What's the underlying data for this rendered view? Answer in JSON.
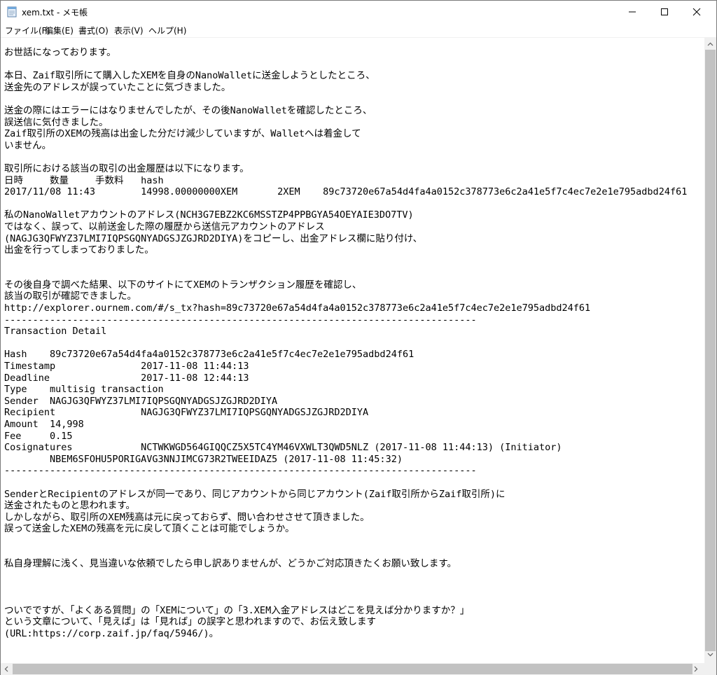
{
  "window": {
    "title": "xem.txt - メモ帳",
    "app_icon": "notepad-icon",
    "controls": {
      "minimize": "minimize-icon",
      "maximize": "maximize-icon",
      "close": "close-icon"
    }
  },
  "menu": {
    "file": "ファイル(F)",
    "edit": "編集(E)",
    "format": "書式(O)",
    "view": "表示(V)",
    "help": "ヘルプ(H)"
  },
  "document": {
    "text": "お世話になっております。\n\n本日、Zaif取引所にて購入したXEMを自身のNanoWalletに送金しようとしたところ、\n送金先のアドレスが誤っていたことに気づきました。\n\n送金の際にはエラーにはなりませんでしたが、その後NanoWalletを確認したところ、\n誤送信に気付きました。\nZaif取引所のXEMの残高は出金した分だけ減少していますが、Walletへは着金して\nいません。\n\n取引所における該当の取引の出金履歴は以下になります。\n日時\t数量\t手数料\thash\n2017/11/08 11:43\t14998.00000000XEM\t2XEM\t89c73720e67a54d4fa4a0152c378773e6c2a41e5f7c4ec7e2e1e795adbd24f61\n\n私のNanoWalletアカウントのアドレス(NCH3G7EBZ2KC6MSSTZP4PPBGYA54OEYAIE3DO7TV)\nではなく、誤って、以前送金した際の履歴から送信元アカウントのアドレス\n(NAGJG3QFWYZ37LMI7IQPSGQNYADGSJZGJRD2DIYA)をコピーし、出金アドレス欄に貼り付け、\n出金を行ってしまっておりました。\n\n\nその後自身で調べた結果、以下のサイトにてXEMのトランザクション履歴を確認し、\n該当の取引が確認できました。\nhttp://explorer.ournem.com/#/s_tx?hash=89c73720e67a54d4fa4a0152c378773e6c2a41e5f7c4ec7e2e1e795adbd24f61\n-----------------------------------------------------------------------------------\nTransaction Detail\n\nHash\t89c73720e67a54d4fa4a0152c378773e6c2a41e5f7c4ec7e2e1e795adbd24f61\nTimestamp\t\t2017-11-08 11:44:13\nDeadline\t\t2017-11-08 12:44:13\nType\tmultisig transaction\nSender\tNAGJG3QFWYZ37LMI7IQPSGQNYADGSJZGJRD2DIYA\nRecipient\t\tNAGJG3QFWYZ37LMI7IQPSGQNYADGSJZGJRD2DIYA\nAmount\t14,998\nFee\t0.15\nCosignatures\t\tNCTWKWGD564GIQQCZ5X5TC4YM46VXWLT3QWD5NLZ (2017-11-08 11:44:13) (Initiator)\n\tNBEM6SFOHU5PORIGAVG3NNJIMCG73R2TWEEIDAZ5 (2017-11-08 11:45:32)\n-----------------------------------------------------------------------------------\n\nSenderとRecipientのアドレスが同一であり、同じアカウントから同じアカウント(Zaif取引所からZaif取引所)に\n送金されたものと思われます。\nしかしながら、取引所のXEM残高は元に戻っておらず、問い合わせさせて頂きました。\n誤って送金したXEMの残高を元に戻して頂くことは可能でしょうか。\n\n\n私自身理解に浅く、見当違いな依頼でしたら申し訳ありませんが、どうかご対応頂きたくお願い致します。\n\n\n\nついでですが、「よくある質問」の「XEMについて」の「3.XEM入金アドレスはどこを見えば分かりますか？」\nという文章について、「見えば」は「見れば」の誤字と思われますので、お伝え致します\n(URL:https://corp.zaif.jp/faq/5946/)。"
  }
}
